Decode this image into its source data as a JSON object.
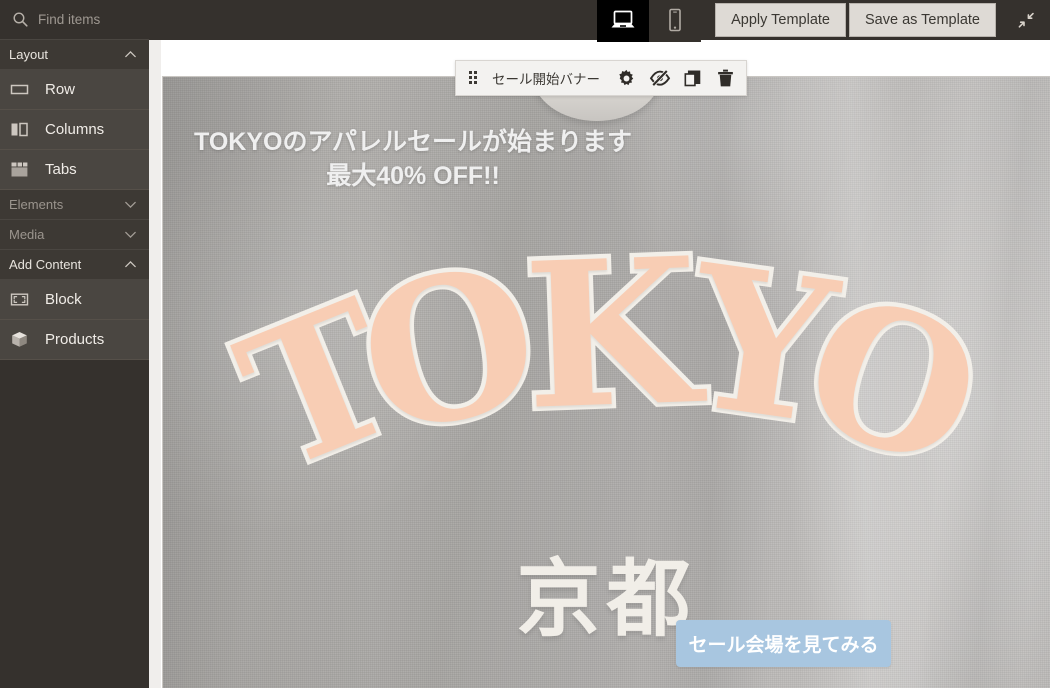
{
  "app": {
    "title": "Page Builder"
  },
  "search": {
    "placeholder": "Find items",
    "value": "",
    "icon": "search-icon"
  },
  "toolbar": {
    "devices": [
      {
        "name": "desktop",
        "icon": "desktop-icon",
        "active": true
      },
      {
        "name": "mobile",
        "icon": "mobile-icon",
        "active": false
      }
    ],
    "apply_template_label": "Apply Template",
    "save_as_template_label": "Save as Template",
    "collapse_icon": "collapse-arrows-icon"
  },
  "sidebar": {
    "sections": [
      {
        "label": "Layout",
        "expanded": true,
        "chevron": "chevron-up-icon",
        "items": [
          {
            "label": "Row",
            "icon": "row-icon"
          },
          {
            "label": "Columns",
            "icon": "columns-icon"
          },
          {
            "label": "Tabs",
            "icon": "tabs-icon"
          }
        ]
      },
      {
        "label": "Elements",
        "expanded": false,
        "chevron": "chevron-down-icon",
        "items": []
      },
      {
        "label": "Media",
        "expanded": false,
        "chevron": "chevron-down-icon",
        "items": []
      },
      {
        "label": "Add Content",
        "expanded": true,
        "chevron": "chevron-up-icon",
        "items": [
          {
            "label": "Block",
            "icon": "block-icon"
          },
          {
            "label": "Products",
            "icon": "products-box-icon"
          }
        ]
      }
    ]
  },
  "element_toolbar": {
    "handle_icon": "drag-handle-icon",
    "label": "セール開始バナー",
    "actions": [
      {
        "name": "settings",
        "icon": "gear-icon"
      },
      {
        "name": "hide",
        "icon": "eye-slash-icon"
      },
      {
        "name": "duplicate",
        "icon": "copy-icon"
      },
      {
        "name": "delete",
        "icon": "trash-icon"
      }
    ]
  },
  "banner": {
    "headline_line1": "TOKYOのアパレルセールが始まります",
    "headline_line2": "最大40% OFF!!",
    "cta_label": "セール会場を見てみる",
    "artwork": {
      "main_text": "TOKYO",
      "letters": [
        "T",
        "O",
        "K",
        "Y",
        "O"
      ],
      "sub_text": "京都"
    }
  },
  "colors": {
    "sidebar_bg": "#35312d",
    "sidebar_item_bg": "#4a4641",
    "sidebar_section_bg": "#3d3934",
    "topbar_bg": "#35312d",
    "device_active_bg": "#000000",
    "template_button_bg": "#dedad5",
    "canvas_bg": "#ffffff",
    "cta_bg": "#a8c6e0",
    "artwork_fill": "#f8cdb4",
    "artwork_outline": "#f2efe9",
    "toolbar_bg": "#f3f2f0"
  }
}
